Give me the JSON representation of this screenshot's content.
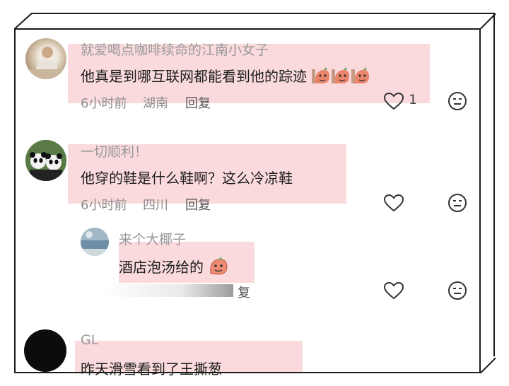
{
  "comments": [
    {
      "username": "就爱喝点咖啡续命的江南小女子",
      "text": "他真是到哪互联网都能看到他的踪迹",
      "time": "6小时前",
      "location": "湖南",
      "reply_label": "回复",
      "like_count": "1"
    },
    {
      "username": "一切顺利！",
      "text": "他穿的鞋是什么鞋啊？这么冷凉鞋",
      "time": "6小时前",
      "location": "四川",
      "reply_label": "回复"
    },
    {
      "username": "来个大椰子",
      "text": "酒店泡汤给的",
      "reply_label": "复"
    },
    {
      "username": "GL",
      "text": "昨天滑雪看到了王撕葱"
    }
  ],
  "icons": {
    "like": "heart-outline-icon",
    "dislike": "meh-face-icon",
    "sticker": "sausage-face-sticker"
  },
  "colors": {
    "highlight": "#fadadd"
  }
}
